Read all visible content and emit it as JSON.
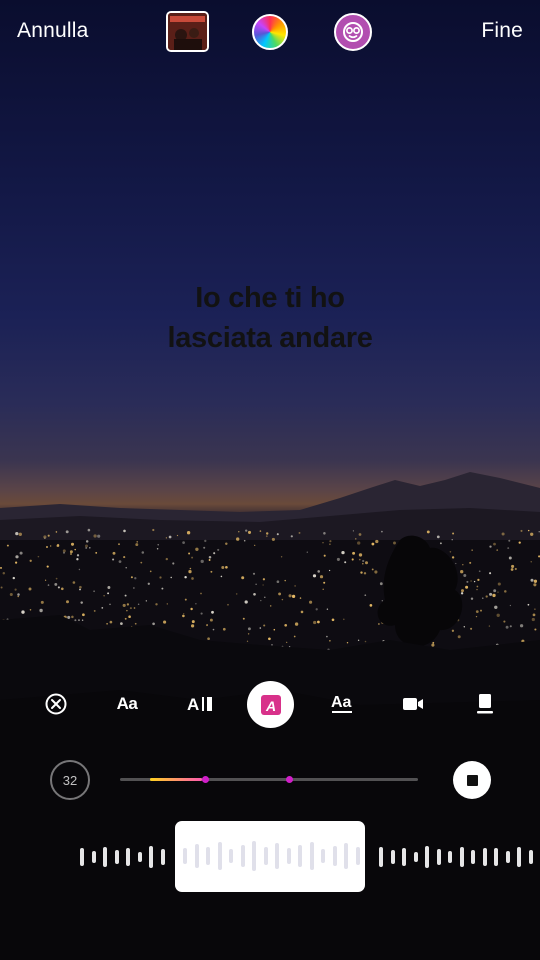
{
  "top_bar": {
    "cancel_label": "Annulla",
    "done_label": "Fine",
    "album_cover_icon": "album-art",
    "color_picker_icon": "color-wheel",
    "effects_icon": "face-effect"
  },
  "lyrics": {
    "line1": "Io che ti ho",
    "line2": "lasciata andare",
    "color": "#121212"
  },
  "tools": [
    {
      "name": "remove",
      "icon": "close-circle-icon"
    },
    {
      "name": "font-size",
      "label": "Aa"
    },
    {
      "name": "text-cursor",
      "label": "A"
    },
    {
      "name": "text-style",
      "label": "A",
      "selected": true,
      "accent": "#d8318a"
    },
    {
      "name": "font-style",
      "label": "Aa"
    },
    {
      "name": "video",
      "icon": "video-icon"
    },
    {
      "name": "card",
      "icon": "card-icon"
    }
  ],
  "timeline": {
    "duration": "32",
    "played_colors": [
      "#ffd21f",
      "#ff5ab0"
    ],
    "marker_color": "#d11ec9"
  },
  "colors": {
    "sky_top": "#0a0d2e",
    "sky_horizon": "#6a4a3a"
  }
}
